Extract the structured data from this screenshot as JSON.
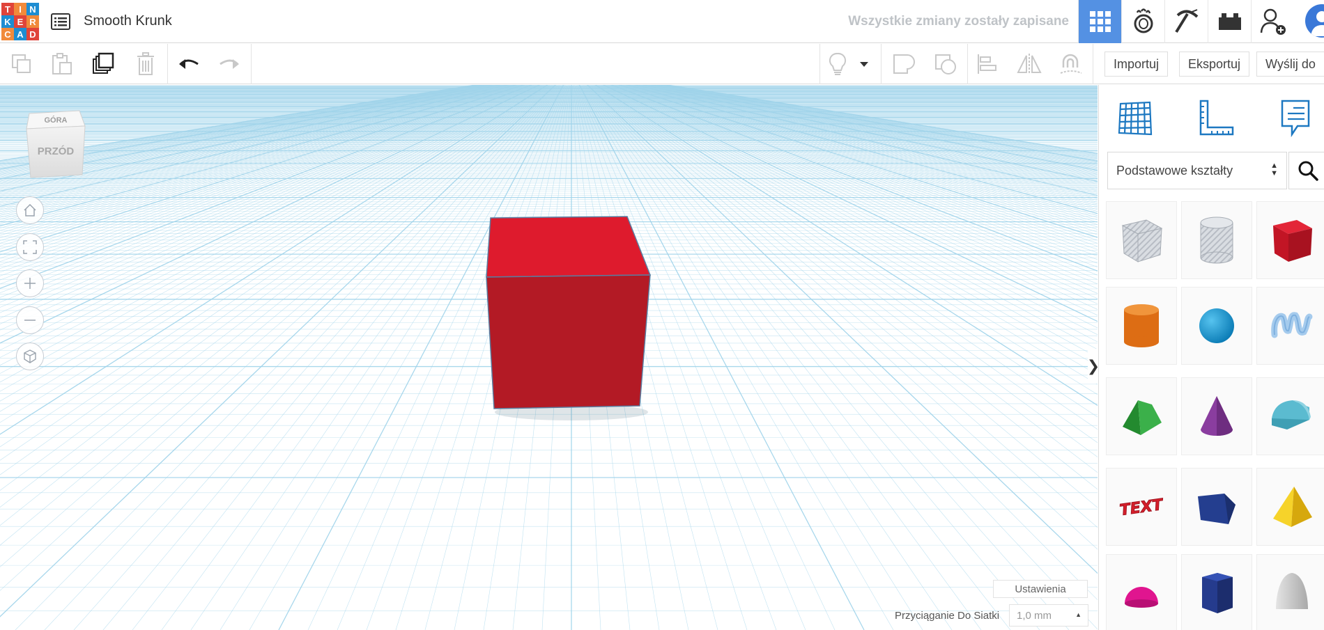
{
  "logo": {
    "letters": [
      "T",
      "I",
      "N",
      "K",
      "E",
      "R",
      "C",
      "A",
      "D"
    ]
  },
  "project": {
    "title": "Smooth Krunk"
  },
  "header": {
    "save_status": "Wszystkie zmiany zostały zapisane",
    "accent": "#5491e3"
  },
  "toolbar": {
    "import_label": "Importuj",
    "export_label": "Eksportuj",
    "send_label": "Wyślij do"
  },
  "viewcube": {
    "top_label": "GÓRA",
    "front_label": "PRZÓD"
  },
  "workplane": {
    "settings_label": "Ustawienia",
    "snap_label": "Przyciąganie Do Siatki",
    "snap_value": "1,0 mm",
    "grid_color": "#9fd3ea",
    "object": {
      "type": "box",
      "color": "#c8192b"
    }
  },
  "panel": {
    "category": "Podstawowe kształty",
    "shapes": [
      {
        "name": "box-hole"
      },
      {
        "name": "cylinder-hole"
      },
      {
        "name": "box",
        "color": "#d6182b"
      },
      {
        "name": "cylinder",
        "color": "#e87817"
      },
      {
        "name": "sphere",
        "color": "#1a9ad6"
      },
      {
        "name": "scribble",
        "color": "#9cc5e8"
      },
      {
        "name": "roof",
        "color": "#2ea23b"
      },
      {
        "name": "cone",
        "color": "#8b3fa0"
      },
      {
        "name": "round-roof",
        "color": "#5fbcd0"
      },
      {
        "name": "text",
        "color": "#d61f2b"
      },
      {
        "name": "wedge",
        "color": "#243e8f"
      },
      {
        "name": "pyramid",
        "color": "#f2c619"
      },
      {
        "name": "half-sphere",
        "color": "#e0158f"
      },
      {
        "name": "polygon",
        "color": "#253b8d"
      },
      {
        "name": "paraboloid",
        "color": "#c9c9c9"
      }
    ]
  }
}
